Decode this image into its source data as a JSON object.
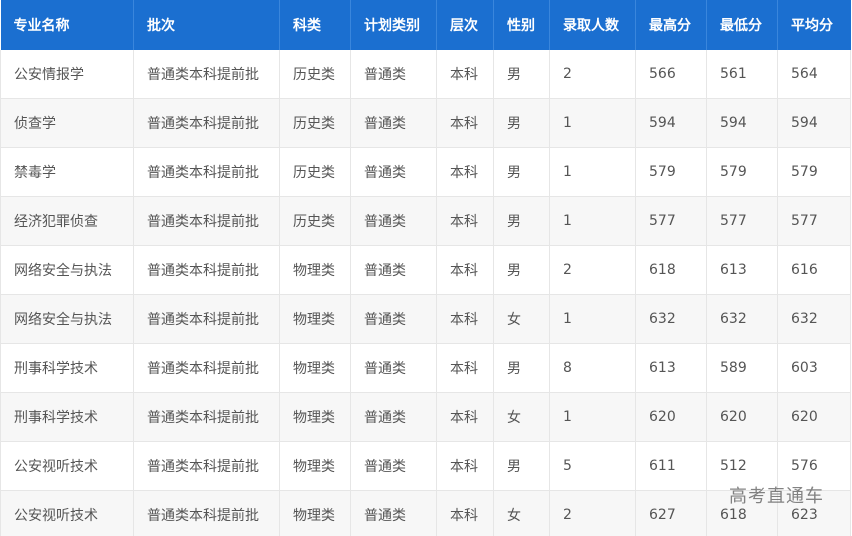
{
  "table": {
    "headers": [
      "专业名称",
      "批次",
      "科类",
      "计划类别",
      "层次",
      "性别",
      "录取人数",
      "最高分",
      "最低分",
      "平均分"
    ],
    "rows": [
      [
        "公安情报学",
        "普通类本科提前批",
        "历史类",
        "普通类",
        "本科",
        "男",
        "2",
        "566",
        "561",
        "564"
      ],
      [
        "侦查学",
        "普通类本科提前批",
        "历史类",
        "普通类",
        "本科",
        "男",
        "1",
        "594",
        "594",
        "594"
      ],
      [
        "禁毒学",
        "普通类本科提前批",
        "历史类",
        "普通类",
        "本科",
        "男",
        "1",
        "579",
        "579",
        "579"
      ],
      [
        "经济犯罪侦查",
        "普通类本科提前批",
        "历史类",
        "普通类",
        "本科",
        "男",
        "1",
        "577",
        "577",
        "577"
      ],
      [
        "网络安全与执法",
        "普通类本科提前批",
        "物理类",
        "普通类",
        "本科",
        "男",
        "2",
        "618",
        "613",
        "616"
      ],
      [
        "网络安全与执法",
        "普通类本科提前批",
        "物理类",
        "普通类",
        "本科",
        "女",
        "1",
        "632",
        "632",
        "632"
      ],
      [
        "刑事科学技术",
        "普通类本科提前批",
        "物理类",
        "普通类",
        "本科",
        "男",
        "8",
        "613",
        "589",
        "603"
      ],
      [
        "刑事科学技术",
        "普通类本科提前批",
        "物理类",
        "普通类",
        "本科",
        "女",
        "1",
        "620",
        "620",
        "620"
      ],
      [
        "公安视听技术",
        "普通类本科提前批",
        "物理类",
        "普通类",
        "本科",
        "男",
        "5",
        "611",
        "512",
        "576"
      ],
      [
        "公安视听技术",
        "普通类本科提前批",
        "物理类",
        "普通类",
        "本科",
        "女",
        "2",
        "627",
        "618",
        "623"
      ]
    ]
  },
  "watermark": "高考直通车",
  "colors": {
    "header_bg": "#1b6fd0",
    "header_text": "#ffffff",
    "row_alt_bg": "#f7f7f7",
    "cell_text": "#555555"
  }
}
